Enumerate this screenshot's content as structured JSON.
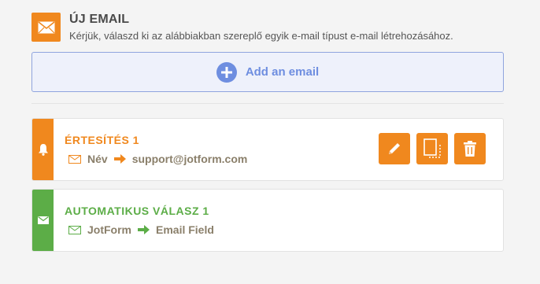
{
  "header": {
    "title": "ÚJ EMAIL",
    "description": "Kérjük, válaszd ki az alábbiakban szereplő egyik e-mail típust e-mail létrehozásához."
  },
  "add_email": {
    "label": "Add an email"
  },
  "emails": [
    {
      "title": "ÉRTESÍTÉS 1",
      "from": "Név",
      "to": "support@jotform.com",
      "color": "#f0881e",
      "icon": "bell-icon"
    },
    {
      "title": "AUTOMATIKUS VÁLASZ 1",
      "from": "JotForm",
      "to": "Email Field",
      "color": "#5cad47",
      "icon": "envelope-icon"
    }
  ],
  "actions": [
    "edit-icon",
    "clone-icon",
    "trash-icon"
  ],
  "colors": {
    "accent": "#f0881e",
    "blue": "#6e8ee0",
    "green": "#5cad47"
  }
}
